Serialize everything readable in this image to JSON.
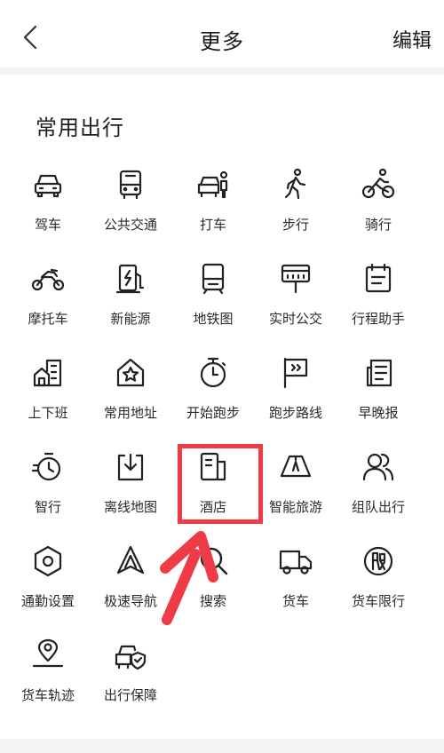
{
  "header": {
    "title": "更多",
    "edit_label": "编辑"
  },
  "section": {
    "title": "常用出行"
  },
  "items": [
    {
      "label": "驾车",
      "icon": "car-icon"
    },
    {
      "label": "公共交通",
      "icon": "bus-icon"
    },
    {
      "label": "打车",
      "icon": "taxi-icon"
    },
    {
      "label": "步行",
      "icon": "walk-icon"
    },
    {
      "label": "骑行",
      "icon": "bike-icon"
    },
    {
      "label": "摩托车",
      "icon": "motorcycle-icon"
    },
    {
      "label": "新能源",
      "icon": "charging-station-icon"
    },
    {
      "label": "地铁图",
      "icon": "subway-icon"
    },
    {
      "label": "实时公交",
      "icon": "bus-stop-icon"
    },
    {
      "label": "行程助手",
      "icon": "calendar-icon"
    },
    {
      "label": "上下班",
      "icon": "commute-building-icon"
    },
    {
      "label": "常用地址",
      "icon": "home-star-icon"
    },
    {
      "label": "开始跑步",
      "icon": "stopwatch-icon"
    },
    {
      "label": "跑步路线",
      "icon": "flag-icon"
    },
    {
      "label": "早晚报",
      "icon": "newspaper-icon"
    },
    {
      "label": "智行",
      "icon": "smart-travel-icon"
    },
    {
      "label": "离线地图",
      "icon": "download-icon"
    },
    {
      "label": "酒店",
      "icon": "hotel-icon"
    },
    {
      "label": "智能旅游",
      "icon": "tour-icon"
    },
    {
      "label": "组队出行",
      "icon": "team-icon"
    },
    {
      "label": "通勤设置",
      "icon": "hexagon-settings-icon"
    },
    {
      "label": "极速导航",
      "icon": "navigation-arrow-icon"
    },
    {
      "label": "搜索",
      "icon": "search-icon"
    },
    {
      "label": "货车",
      "icon": "truck-icon"
    },
    {
      "label": "货车限行",
      "icon": "restriction-icon"
    },
    {
      "label": "货车轨迹",
      "icon": "location-track-icon"
    },
    {
      "label": "出行保障",
      "icon": "car-shield-icon"
    }
  ],
  "annotation": {
    "color": "#ee3b45",
    "highlighted_item": "酒店"
  }
}
